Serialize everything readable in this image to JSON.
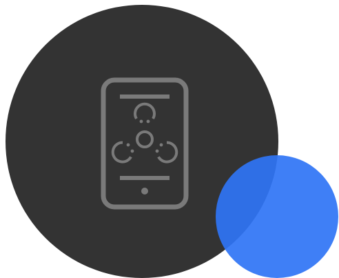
{
  "colors": {
    "dark_circle": "#333333",
    "icon_stroke": "#7a7a7a",
    "blue_circle": "#2f74f5",
    "background": "#ffffff"
  },
  "icons": {
    "main": "mobile-phone-icon",
    "inner": "biohazard-icon"
  }
}
